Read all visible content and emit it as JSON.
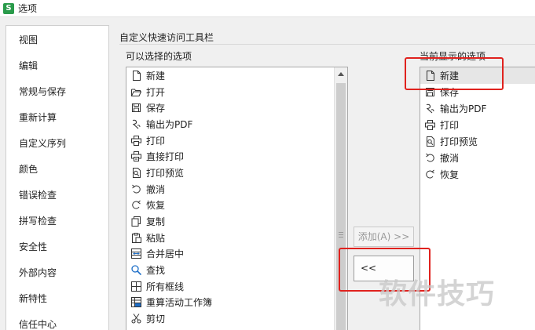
{
  "window": {
    "title": "选项",
    "app_icon_letter": "S"
  },
  "sidebar": {
    "items": [
      {
        "label": "视图"
      },
      {
        "label": "编辑"
      },
      {
        "label": "常规与保存"
      },
      {
        "label": "重新计算"
      },
      {
        "label": "自定义序列"
      },
      {
        "label": "颜色"
      },
      {
        "label": "错误检查"
      },
      {
        "label": "拼写检查"
      },
      {
        "label": "安全性"
      },
      {
        "label": "外部内容"
      },
      {
        "label": "新特性"
      },
      {
        "label": "信任中心"
      }
    ]
  },
  "main": {
    "group_title": "自定义快速访问工具栏",
    "available_label": "可以选择的选项",
    "current_label": "当前显示的选项",
    "available_items": [
      {
        "label": "新建",
        "icon": "new-doc-icon"
      },
      {
        "label": "打开",
        "icon": "open-folder-icon"
      },
      {
        "label": "保存",
        "icon": "save-icon"
      },
      {
        "label": "输出为PDF",
        "icon": "pdf-export-icon"
      },
      {
        "label": "打印",
        "icon": "print-icon"
      },
      {
        "label": "直接打印",
        "icon": "direct-print-icon"
      },
      {
        "label": "打印预览",
        "icon": "print-preview-icon"
      },
      {
        "label": "撤消",
        "icon": "undo-icon"
      },
      {
        "label": "恢复",
        "icon": "redo-icon"
      },
      {
        "label": "复制",
        "icon": "copy-icon"
      },
      {
        "label": "粘贴",
        "icon": "paste-icon"
      },
      {
        "label": "合并居中",
        "icon": "merge-center-icon"
      },
      {
        "label": "查找",
        "icon": "find-icon"
      },
      {
        "label": "所有框线",
        "icon": "all-borders-icon"
      },
      {
        "label": "重算活动工作簿",
        "icon": "recalc-workbook-icon"
      },
      {
        "label": "剪切",
        "icon": "cut-icon"
      }
    ],
    "current_items": [
      {
        "label": "新建",
        "icon": "new-doc-icon"
      },
      {
        "label": "保存",
        "icon": "save-icon"
      },
      {
        "label": "输出为PDF",
        "icon": "pdf-export-icon"
      },
      {
        "label": "打印",
        "icon": "print-icon"
      },
      {
        "label": "打印预览",
        "icon": "print-preview-icon"
      },
      {
        "label": "撤消",
        "icon": "undo-icon"
      },
      {
        "label": "恢复",
        "icon": "redo-icon"
      }
    ],
    "add_button": "添加(A) >>",
    "remove_button": "<<"
  },
  "watermark": "软件技巧",
  "colors": {
    "highlight": "#e0221e",
    "app_icon": "#2a9b4b"
  }
}
